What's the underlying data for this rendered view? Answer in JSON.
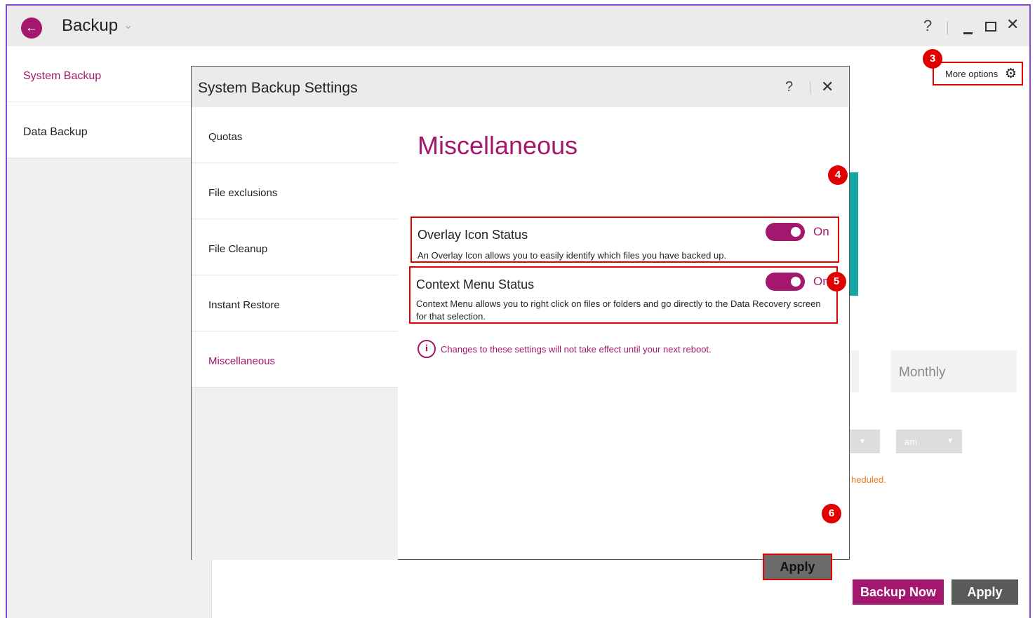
{
  "window": {
    "title": "Backup",
    "help_label": "?",
    "close_label": "✕"
  },
  "sidebar": {
    "items": [
      {
        "label": "System Backup",
        "active": true
      },
      {
        "label": "Data Backup",
        "active": false
      }
    ]
  },
  "background": {
    "more_options_label": "More options",
    "frequency_tab_label": "Monthly",
    "ampm_value": "am",
    "schedule_note": "heduled.",
    "backup_now_label": "Backup Now",
    "apply_label": "Apply"
  },
  "modal": {
    "title": "System Backup Settings",
    "help_label": "?",
    "close_label": "✕",
    "nav": [
      {
        "label": "Quotas",
        "active": false
      },
      {
        "label": "File exclusions",
        "active": false
      },
      {
        "label": "File Cleanup",
        "active": false
      },
      {
        "label": "Instant Restore",
        "active": false
      },
      {
        "label": "Miscellaneous",
        "active": true
      }
    ],
    "section_title": "Miscellaneous",
    "settings": [
      {
        "title": "Overlay Icon Status",
        "state": "On",
        "description": "An Overlay Icon allows you to easily identify which files you have backed up."
      },
      {
        "title": "Context Menu Status",
        "state": "On",
        "description": "Context Menu allows you to right click on files or folders and go directly to the Data Recovery screen for that selection."
      }
    ],
    "info_note": "Changes to these settings will not take effect until your next reboot.",
    "apply_label": "Apply"
  },
  "callouts": [
    "3",
    "4",
    "5",
    "6"
  ],
  "colors": {
    "accent": "#a3176e",
    "callout_red": "#e00000",
    "teal": "#16a5a5",
    "warning_orange": "#f07a1e"
  }
}
